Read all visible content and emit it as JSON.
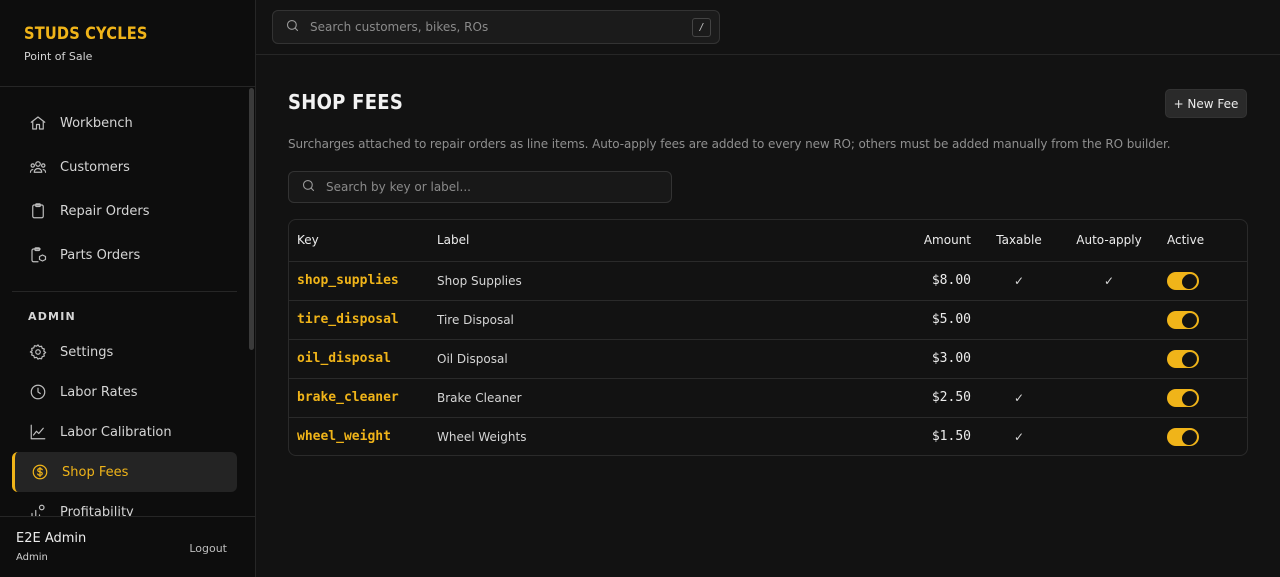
{
  "brand": {
    "name": "STUDS CYCLES",
    "subtitle": "Point of Sale"
  },
  "colors": {
    "accent": "#f0b419",
    "background": "#121212",
    "sidebar": "#0d0d0d"
  },
  "sidebar": {
    "items": [
      {
        "label": "Workbench",
        "icon": "home-icon"
      },
      {
        "label": "Customers",
        "icon": "users-icon"
      },
      {
        "label": "Repair Orders",
        "icon": "clipboard-icon"
      },
      {
        "label": "Parts Orders",
        "icon": "clipboard-box-icon"
      }
    ],
    "admin_label": "ADMIN",
    "admin_items": [
      {
        "label": "Settings",
        "icon": "gear-icon"
      },
      {
        "label": "Labor Rates",
        "icon": "clock-icon"
      },
      {
        "label": "Labor Calibration",
        "icon": "chart-line-icon"
      },
      {
        "label": "Shop Fees",
        "icon": "dollar-circle-icon",
        "active": true
      },
      {
        "label": "Profitability",
        "icon": "profit-icon"
      }
    ],
    "user": {
      "name": "E2E Admin",
      "role": "Admin"
    },
    "logout_label": "Logout"
  },
  "topbar": {
    "search_placeholder": "Search customers, bikes, ROs",
    "shortcut": "/"
  },
  "page": {
    "title": "SHOP FEES",
    "new_button": "+ New Fee",
    "description": "Surcharges attached to repair orders as line items. Auto-apply fees are added to every new RO; others must be added manually from the RO builder.",
    "search_placeholder": "Search by key or label..."
  },
  "table": {
    "headers": {
      "key": "Key",
      "label": "Label",
      "amount": "Amount",
      "taxable": "Taxable",
      "auto": "Auto-apply",
      "active": "Active"
    },
    "rows": [
      {
        "key": "shop_supplies",
        "label": "Shop Supplies",
        "amount": "$8.00",
        "taxable": "✓",
        "auto": "✓",
        "active": true
      },
      {
        "key": "tire_disposal",
        "label": "Tire Disposal",
        "amount": "$5.00",
        "taxable": "",
        "auto": "",
        "active": true
      },
      {
        "key": "oil_disposal",
        "label": "Oil Disposal",
        "amount": "$3.00",
        "taxable": "",
        "auto": "",
        "active": true
      },
      {
        "key": "brake_cleaner",
        "label": "Brake Cleaner",
        "amount": "$2.50",
        "taxable": "✓",
        "auto": "",
        "active": true
      },
      {
        "key": "wheel_weight",
        "label": "Wheel Weights",
        "amount": "$1.50",
        "taxable": "✓",
        "auto": "",
        "active": true
      }
    ]
  }
}
